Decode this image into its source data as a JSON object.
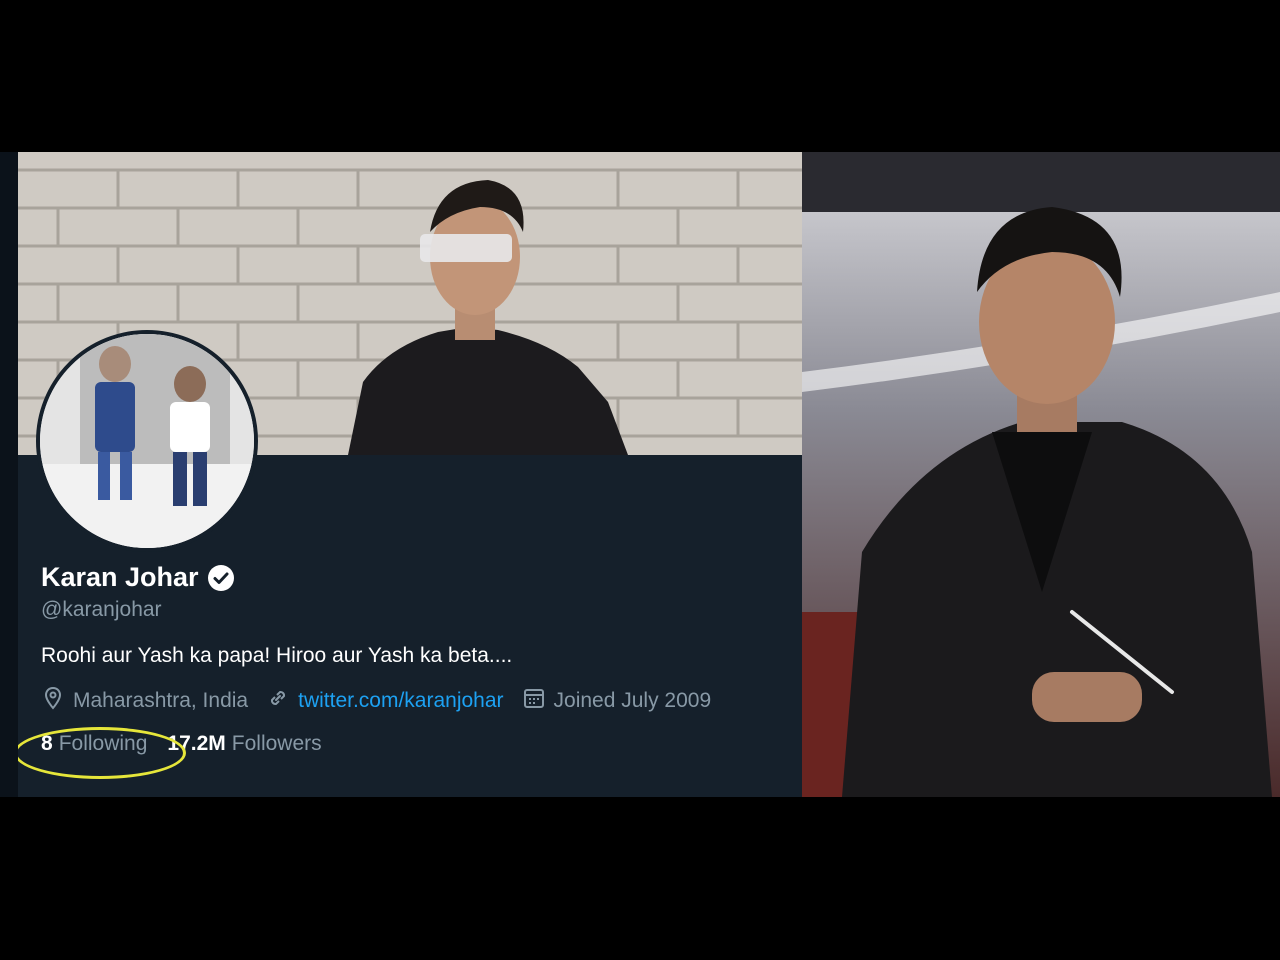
{
  "profile": {
    "name": "Karan Johar",
    "handle": "@karanjohar",
    "bio": "Roohi aur Yash ka papa! Hiroo aur Yash ka beta....",
    "location": "Maharashtra, India",
    "website": "twitter.com/karanjohar",
    "joined": "Joined July 2009",
    "following_count": "8",
    "following_label": "Following",
    "followers_count": "17.2M",
    "followers_label": "Followers"
  },
  "icons": {
    "verified": "verified-badge-icon",
    "location": "location-pin-icon",
    "link": "link-icon",
    "calendar": "calendar-icon"
  },
  "colors": {
    "background": "#15202b",
    "text_primary": "#ffffff",
    "text_secondary": "#8899a6",
    "link": "#1da1f2",
    "highlight": "#e6e63a"
  }
}
